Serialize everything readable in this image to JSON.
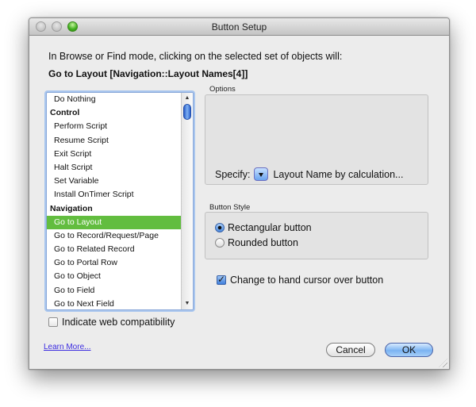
{
  "window": {
    "title": "Button Setup",
    "controls": [
      "close",
      "minimize",
      "zoom"
    ]
  },
  "intro_text": "In Browse or Find mode, clicking on the selected set of objects will:",
  "current_step": "Go to Layout [Navigation::Layout Names[4]]",
  "step_list": {
    "items": [
      {
        "label": "Do Nothing",
        "type": "item"
      },
      {
        "label": "Control",
        "type": "header"
      },
      {
        "label": "Perform Script",
        "type": "item"
      },
      {
        "label": "Resume Script",
        "type": "item"
      },
      {
        "label": "Exit Script",
        "type": "item"
      },
      {
        "label": "Halt Script",
        "type": "item"
      },
      {
        "label": "Set Variable",
        "type": "item"
      },
      {
        "label": "Install OnTimer Script",
        "type": "item"
      },
      {
        "label": "Navigation",
        "type": "header"
      },
      {
        "label": "Go to Layout",
        "type": "item",
        "selected": true
      },
      {
        "label": "Go to Record/Request/Page",
        "type": "item"
      },
      {
        "label": "Go to Related Record",
        "type": "item"
      },
      {
        "label": "Go to Portal Row",
        "type": "item"
      },
      {
        "label": "Go to Object",
        "type": "item"
      },
      {
        "label": "Go to Field",
        "type": "item"
      },
      {
        "label": "Go to Next Field",
        "type": "item"
      }
    ],
    "selected_color": "#62bd3f"
  },
  "web_compat": {
    "label": "Indicate web compatibility",
    "checked": false
  },
  "learn_more": "Learn More...",
  "options": {
    "label": "Options",
    "specify_label": "Specify:",
    "specify_value": "Layout Name by calculation..."
  },
  "button_style": {
    "label": "Button Style",
    "options": [
      {
        "label": "Rectangular button",
        "selected": true
      },
      {
        "label": "Rounded button",
        "selected": false
      }
    ]
  },
  "hand_cursor": {
    "label": "Change to hand cursor over button",
    "checked": true
  },
  "buttons": {
    "cancel": "Cancel",
    "ok": "OK"
  }
}
